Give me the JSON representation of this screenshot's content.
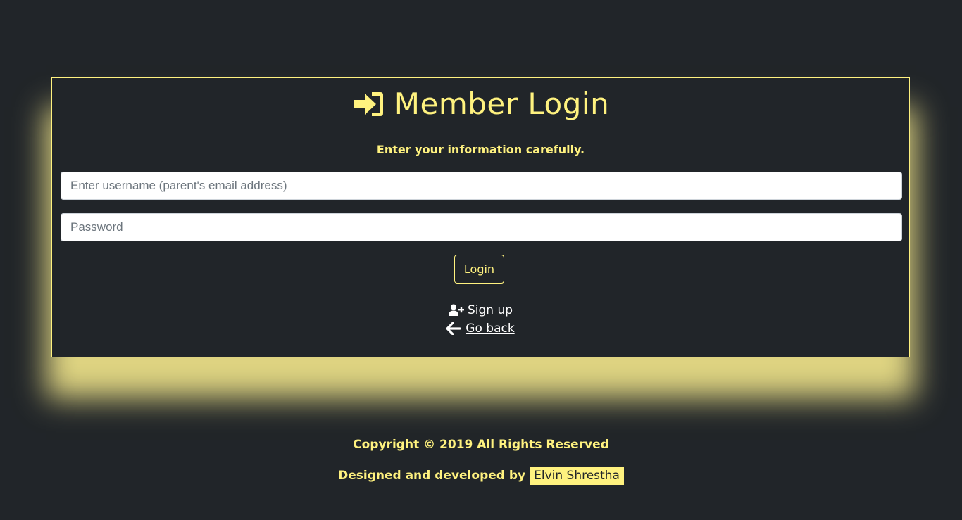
{
  "card": {
    "title": "Member Login",
    "title_icon": "sign-in-icon",
    "subtitle": "Enter your information carefully."
  },
  "form": {
    "username_placeholder": "Enter username (parent's email address)",
    "username_value": "",
    "password_placeholder": "Password",
    "password_value": "",
    "login_label": "Login"
  },
  "links": {
    "signup_label": "Sign up",
    "signup_icon": "user-plus-icon",
    "goback_label": "Go back",
    "goback_icon": "arrow-left-icon"
  },
  "footer": {
    "copyright": "Copyright © 2019 All Rights Reserved",
    "designed_by_label": "Designed and developed by",
    "designer_name": "Elvin Shrestha"
  },
  "colors": {
    "background": "#212529",
    "accent": "#fff27f",
    "link": "#ffffff"
  }
}
